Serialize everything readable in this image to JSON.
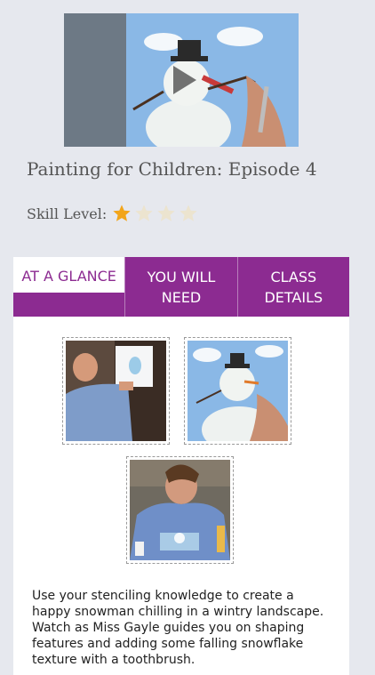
{
  "video": {
    "thumbnail": "snowman-painting-video-still",
    "play_icon": "play-icon"
  },
  "title": "Painting for Children: Episode 4",
  "skill": {
    "label": "Skill Level:",
    "rating": 1,
    "max": 5,
    "filled_color": "#f2a51a",
    "empty_color": "#ece4cf"
  },
  "tabs": [
    {
      "label": "AT A GLANCE",
      "active": true
    },
    {
      "label": "YOU WILL NEED",
      "active": false
    },
    {
      "label": "CLASS DETAILS",
      "active": false
    }
  ],
  "gallery": [
    {
      "name": "photo-man-stenciling"
    },
    {
      "name": "photo-snowman-painting"
    },
    {
      "name": "photo-instructor-toothbrush"
    }
  ],
  "description": "Use your stenciling knowledge to create a happy snowman chilling in a wintry landscape. Watch as Miss Gayle guides you on shaping features and adding some falling snowflake texture with a toothbrush.",
  "colors": {
    "accent": "#8c2b91",
    "background": "#e6e8ee"
  }
}
